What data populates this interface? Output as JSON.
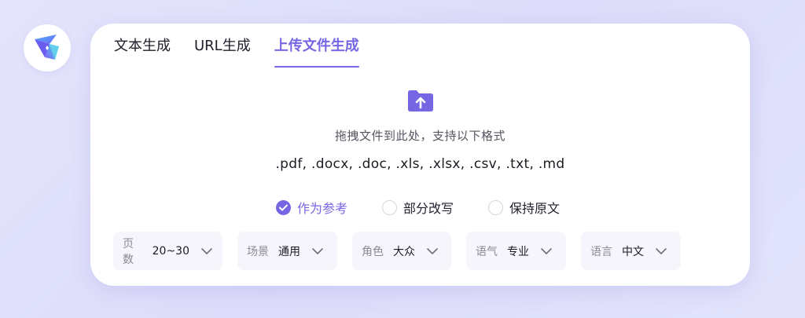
{
  "tabs": [
    {
      "label": "文本生成",
      "active": false
    },
    {
      "label": "URL生成",
      "active": false
    },
    {
      "label": "上传文件生成",
      "active": true
    }
  ],
  "upload": {
    "icon": "folder-upload-icon",
    "hint": "拖拽文件到此处，支持以下格式",
    "formats": ".pdf, .docx, .doc, .xls, .xlsx, .csv, .txt, .md"
  },
  "options": [
    {
      "label": "作为参考",
      "checked": true
    },
    {
      "label": "部分改写",
      "checked": false
    },
    {
      "label": "保持原文",
      "checked": false
    }
  ],
  "selects": [
    {
      "label": "页数",
      "value": "20~30"
    },
    {
      "label": "场景",
      "value": "通用"
    },
    {
      "label": "角色",
      "value": "大众"
    },
    {
      "label": "语气",
      "value": "专业"
    },
    {
      "label": "语言",
      "value": "中文"
    }
  ],
  "colors": {
    "accent": "#7766e3",
    "background": "#e0e1fb",
    "select_bg": "#f5f5fb"
  }
}
